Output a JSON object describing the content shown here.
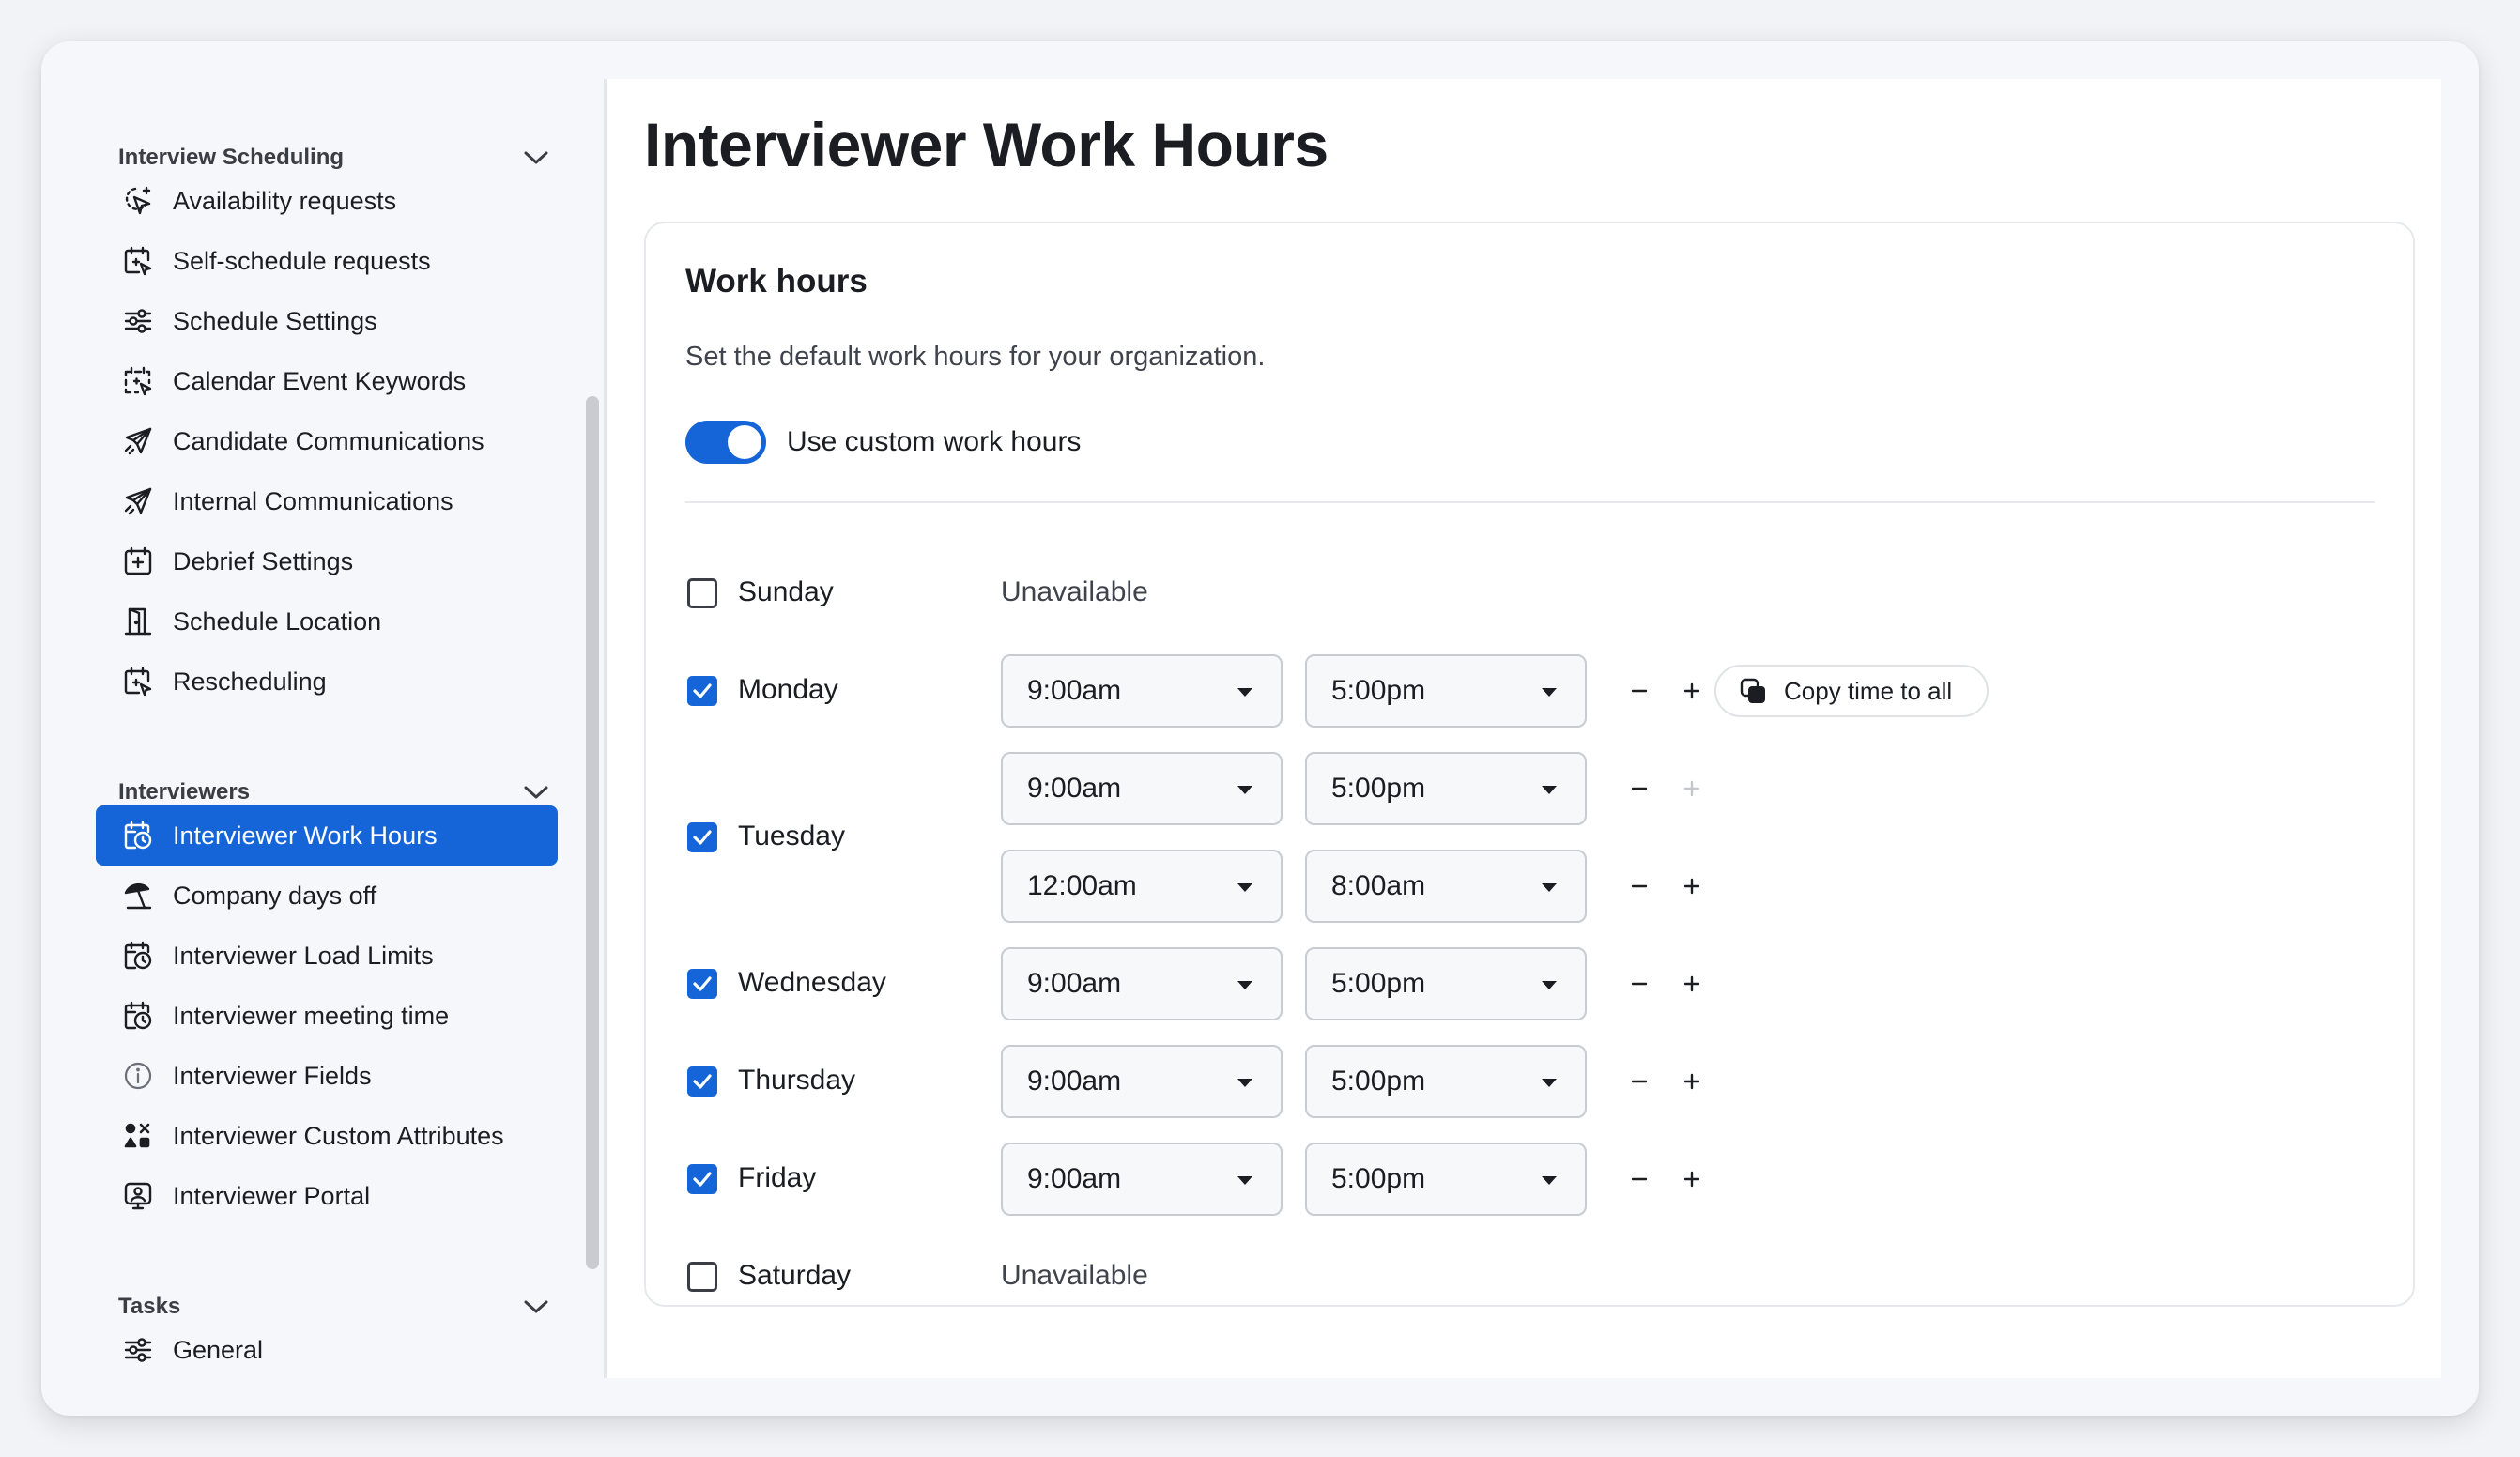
{
  "page": {
    "title": "Interviewer Work Hours"
  },
  "sidebar": {
    "sections": [
      {
        "label": "Interview Scheduling",
        "items": [
          {
            "label": "Availability requests",
            "icon": "cursor-sparkle-icon"
          },
          {
            "label": "Self-schedule requests",
            "icon": "calendar-cursor-icon"
          },
          {
            "label": "Schedule Settings",
            "icon": "sliders-icon"
          },
          {
            "label": "Calendar Event Keywords",
            "icon": "calendar-select-icon"
          },
          {
            "label": "Candidate Communications",
            "icon": "send-icon"
          },
          {
            "label": "Internal Communications",
            "icon": "send-icon"
          },
          {
            "label": "Debrief Settings",
            "icon": "calendar-plus-icon"
          },
          {
            "label": "Schedule Location",
            "icon": "door-icon"
          },
          {
            "label": "Rescheduling",
            "icon": "calendar-cursor-icon"
          }
        ]
      },
      {
        "label": "Interviewers",
        "items": [
          {
            "label": "Interviewer Work Hours",
            "icon": "calendar-clock-icon",
            "active": true
          },
          {
            "label": "Company days off",
            "icon": "beach-umbrella-icon"
          },
          {
            "label": "Interviewer Load Limits",
            "icon": "calendar-clock-icon"
          },
          {
            "label": "Interviewer meeting time",
            "icon": "calendar-clock-icon"
          },
          {
            "label": "Interviewer Fields",
            "icon": "info-icon"
          },
          {
            "label": "Interviewer Custom Attributes",
            "icon": "shapes-icon"
          },
          {
            "label": "Interviewer Portal",
            "icon": "monitor-user-icon"
          }
        ]
      },
      {
        "label": "Tasks",
        "items": [
          {
            "label": "General",
            "icon": "sliders-icon"
          }
        ]
      }
    ]
  },
  "card": {
    "title": "Work hours",
    "description": "Set the default work hours for your organization.",
    "toggle_label": "Use custom work hours",
    "toggle_on": true,
    "copy_label": "Copy time to all",
    "unavailable_label": "Unavailable"
  },
  "days": [
    {
      "name": "Sunday",
      "checked": false,
      "unavailable": "Unavailable"
    },
    {
      "name": "Monday",
      "checked": true,
      "slots": [
        {
          "start": "9:00am",
          "end": "5:00pm"
        }
      ]
    },
    {
      "name": "Tuesday",
      "checked": true,
      "slots": [
        {
          "start": "9:00am",
          "end": "5:00pm"
        },
        {
          "start": "12:00am",
          "end": "8:00am"
        }
      ]
    },
    {
      "name": "Wednesday",
      "checked": true,
      "slots": [
        {
          "start": "9:00am",
          "end": "5:00pm"
        }
      ]
    },
    {
      "name": "Thursday",
      "checked": true,
      "slots": [
        {
          "start": "9:00am",
          "end": "5:00pm"
        }
      ]
    },
    {
      "name": "Friday",
      "checked": true,
      "slots": [
        {
          "start": "9:00am",
          "end": "5:00pm"
        }
      ]
    },
    {
      "name": "Saturday",
      "checked": false,
      "unavailable": "Unavailable"
    }
  ],
  "colors": {
    "accent": "#1565d8",
    "text": "#1b1d22",
    "muted": "#3f434b",
    "border": "#c8cbd1"
  }
}
